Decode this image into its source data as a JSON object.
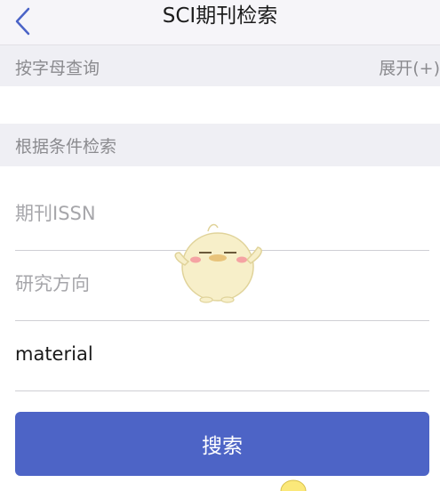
{
  "header": {
    "title": "SCI期刊检索"
  },
  "letter_section": {
    "label": "按字母查询",
    "expand_label": "展开(+)"
  },
  "condition_section": {
    "label": "根据条件检索"
  },
  "fields": {
    "issn": {
      "placeholder": "期刊ISSN",
      "value": ""
    },
    "research_direction": {
      "placeholder": "研究方向",
      "value": ""
    },
    "keyword": {
      "placeholder": "",
      "value": "material"
    }
  },
  "search_button": {
    "label": "搜索"
  },
  "colors": {
    "primary": "#4d64c6",
    "section_bg": "#efeff4",
    "nav_bg": "#f6f5f9",
    "back_icon": "#4a63c7"
  },
  "icons": {
    "back": "chevron-left-icon",
    "overlay": "mascot-sticker-icon"
  }
}
